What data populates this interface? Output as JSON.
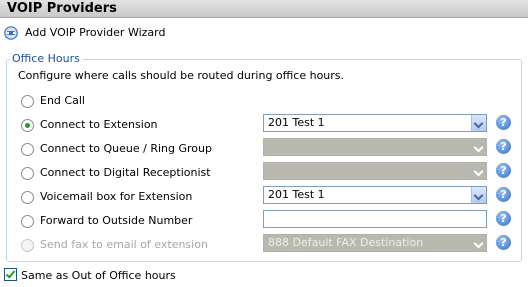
{
  "header": {
    "title": "VOIP Providers"
  },
  "wizard": {
    "label": "Add VOIP Provider Wizard",
    "icon": "wizard-icon"
  },
  "office_hours": {
    "legend": "Office Hours",
    "description": "Configure where calls should be routed during office hours.",
    "options": [
      {
        "label": "End Call",
        "checked": false,
        "disabled": false,
        "control": "none",
        "value": ""
      },
      {
        "label": "Connect to Extension",
        "checked": true,
        "disabled": false,
        "control": "select",
        "value": "201 Test 1"
      },
      {
        "label": "Connect to Queue / Ring Group",
        "checked": false,
        "disabled": false,
        "control": "select-disabled",
        "value": ""
      },
      {
        "label": "Connect to Digital Receptionist",
        "checked": false,
        "disabled": false,
        "control": "select-disabled",
        "value": ""
      },
      {
        "label": "Voicemail box for Extension",
        "checked": false,
        "disabled": false,
        "control": "select",
        "value": "201 Test 1"
      },
      {
        "label": "Forward to Outside Number",
        "checked": false,
        "disabled": false,
        "control": "text",
        "value": ""
      },
      {
        "label": "Send fax to email of extension",
        "checked": false,
        "disabled": true,
        "control": "select-disabled",
        "value": "888 Default FAX Destination"
      }
    ],
    "help_icon": "?"
  },
  "same_as_out_of_office": {
    "label": "Same as Out of Office hours",
    "checked": true
  },
  "colors": {
    "legend": "#1c4f9c",
    "radio_selected": "#2d9a27",
    "checkbox_check": "#21a121",
    "help_icon": "#2f6fc5"
  }
}
